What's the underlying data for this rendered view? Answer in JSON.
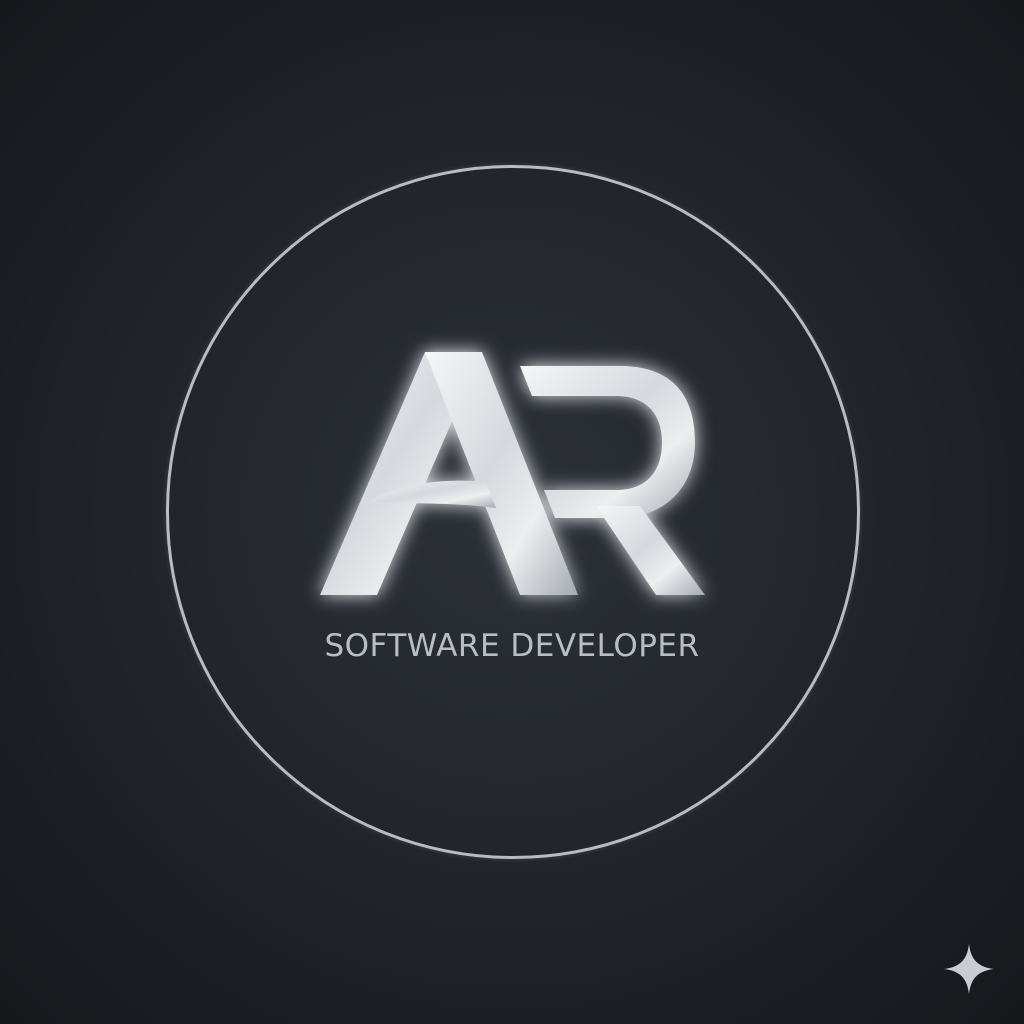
{
  "logo": {
    "initial_1": "A",
    "initial_2": "R",
    "icon": "ar-monogram-icon"
  },
  "tagline": "SOFTWARE DEVELOPER",
  "badge": {
    "icon": "sparkle-icon"
  },
  "colors": {
    "background": "#23272c",
    "ring": "#b7bcc1",
    "metal_light": "#f2f4f6",
    "metal_dark": "#9aa0a6",
    "glow": "#9fc3e6",
    "tagline": "#b9bec3"
  }
}
